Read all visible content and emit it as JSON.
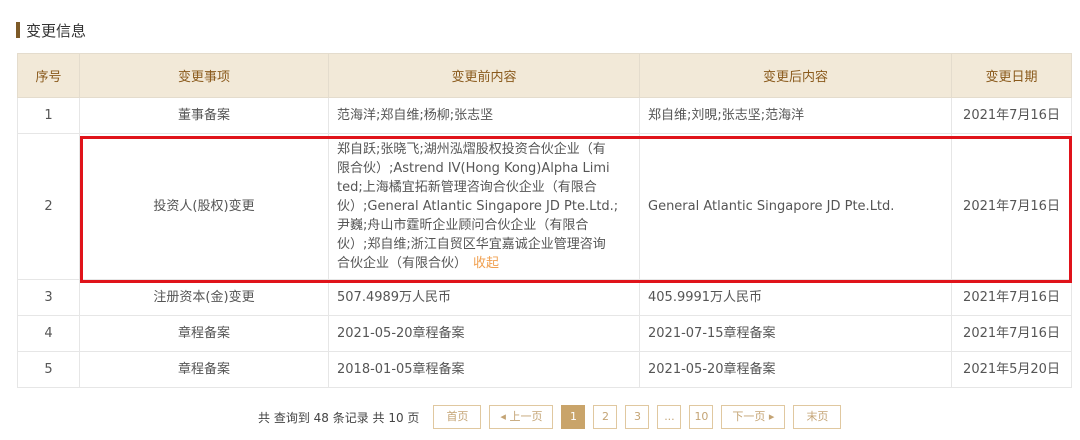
{
  "section": {
    "title": "变更信息"
  },
  "table": {
    "headers": [
      "序号",
      "变更事项",
      "变更前内容",
      "变更后内容",
      "变更日期"
    ],
    "rows": [
      {
        "no": "1",
        "item": "董事备案",
        "before": "范海洋;郑自维;杨柳;张志坚",
        "after": "郑自维;刘晛;张志坚;范海洋",
        "date": "2021年7月16日"
      },
      {
        "no": "2",
        "item": "投资人(股权)变更",
        "before_lines": [
          "郑自跃;张晓飞;湖州泓熠股权投资合伙企业（有",
          "限合伙）;Astrend IV(Hong Kong)Alpha Limi",
          "ted;上海橘宜拓新管理咨询合伙企业（有限合",
          "伙）;General Atlantic Singapore JD Pte.Ltd.;",
          "尹巍;舟山市霆昕企业顾问合伙企业（有限合",
          "伙）;郑自维;浙江自贸区华宜嘉诚企业管理咨询",
          "合伙企业（有限合伙）"
        ],
        "collapse": "收起",
        "after": "General Atlantic Singapore JD Pte.Ltd.",
        "date": "2021年7月16日"
      },
      {
        "no": "3",
        "item": "注册资本(金)变更",
        "before": "507.4989万人民币",
        "after": "405.9991万人民币",
        "date": "2021年7月16日"
      },
      {
        "no": "4",
        "item": "章程备案",
        "before": "2021-05-20章程备案",
        "after": "2021-07-15章程备案",
        "date": "2021年7月16日"
      },
      {
        "no": "5",
        "item": "章程备案",
        "before": "2018-01-05章程备案",
        "after": "2021-05-20章程备案",
        "date": "2021年5月20日"
      }
    ]
  },
  "pagination": {
    "summary": "共 查询到 48 条记录 共 10 页",
    "first": "首页",
    "prev": "◂ 上一页",
    "pages": [
      "1",
      "2",
      "3",
      "...",
      "10"
    ],
    "next": "下一页 ▸",
    "last": "末页"
  },
  "colors": {
    "header_bg": "#f2e9d8",
    "header_text": "#8a5a1c",
    "highlight_box": "#e0131a",
    "link": "#f0a050",
    "active_page": "#c9a46a"
  }
}
